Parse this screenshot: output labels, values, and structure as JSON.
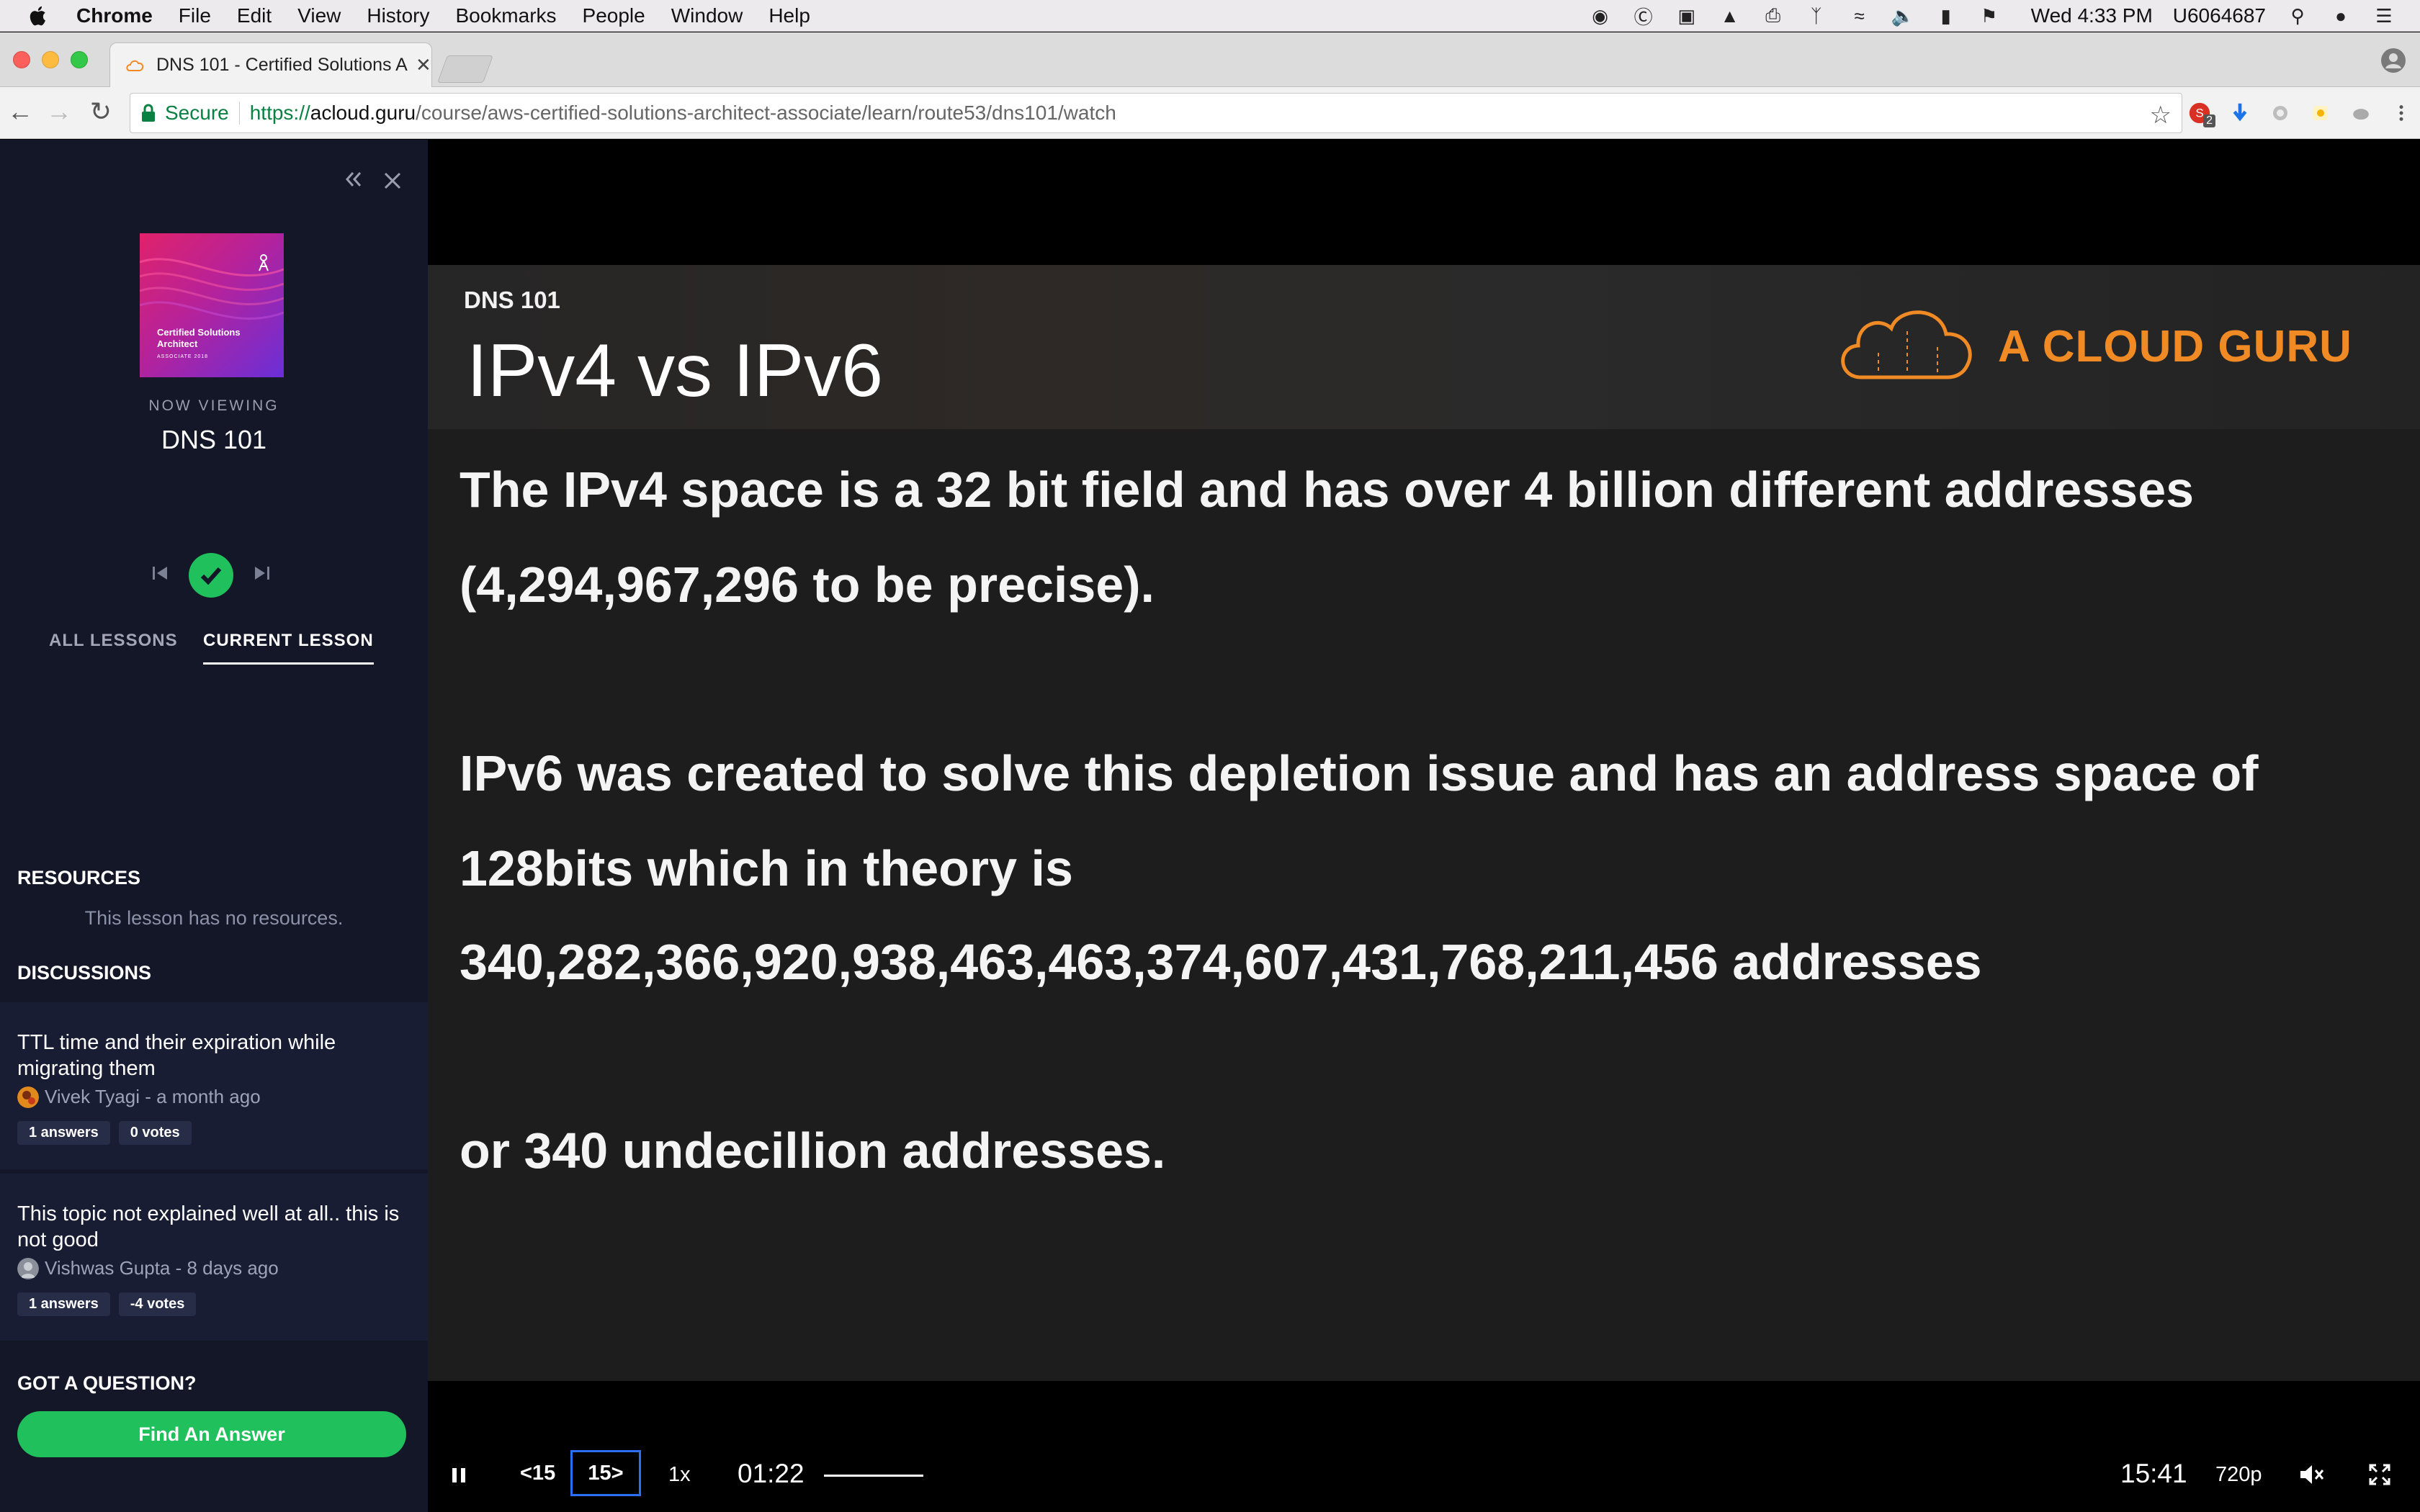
{
  "menubar": {
    "items": [
      "Chrome",
      "File",
      "Edit",
      "View",
      "History",
      "Bookmarks",
      "People",
      "Window",
      "Help"
    ],
    "clock": "Wed 4:33 PM",
    "user": "U6064687"
  },
  "browser": {
    "tab_title": "DNS 101 - Certified Solutions A",
    "secure_label": "Secure",
    "url_scheme": "https://",
    "url_host": "acloud.guru",
    "url_path": "/course/aws-certified-solutions-architect-associate/learn/route53/dns101/watch",
    "extension_badge": "2"
  },
  "sidebar": {
    "thumb_title": "Certified Solutions Architect",
    "thumb_subtitle": "ASSOCIATE 2018",
    "now_viewing": "NOW VIEWING",
    "lesson_title": "DNS 101",
    "tabs": {
      "all": "ALL LESSONS",
      "current": "CURRENT LESSON"
    },
    "resources_heading": "RESOURCES",
    "resources_empty": "This lesson has no resources.",
    "discussions_heading": "DISCUSSIONS",
    "discussions": [
      {
        "title": "TTL time and their expiration while migrating them",
        "author_meta": "Vivek Tyagi - a month ago",
        "answers": "1 answers",
        "votes": "0 votes"
      },
      {
        "title": "This topic not explained well at all.. this is not good",
        "author_meta": "Vishwas Gupta - 8 days ago",
        "answers": "1 answers",
        "votes": "-4 votes"
      }
    ],
    "question_heading": "GOT A QUESTION?",
    "find_answer": "Find An Answer"
  },
  "slide": {
    "kicker": "DNS 101",
    "title": "IPv4 vs IPv6",
    "brand": "A CLOUD GURU",
    "lines": [
      "The IPv4 space is a 32 bit field and has over 4 billion different addresses",
      "(4,294,967,296 to be precise).",
      "IPv6 was created to solve this depletion issue and has an address space of",
      "128bits which in theory is",
      "340,282,366,920,938,463,463,374,607,431,768,211,456 addresses",
      "or 340 undecillion addresses."
    ]
  },
  "player": {
    "rewind": "<15",
    "forward": "15>",
    "speed": "1x",
    "current_time": "01:22",
    "duration": "15:41",
    "quality": "720p"
  },
  "colors": {
    "accent_green": "#20c05c",
    "sidebar_bg": "#141728",
    "brand_orange": "#f08a25",
    "focus_blue": "#2b6ff2"
  }
}
